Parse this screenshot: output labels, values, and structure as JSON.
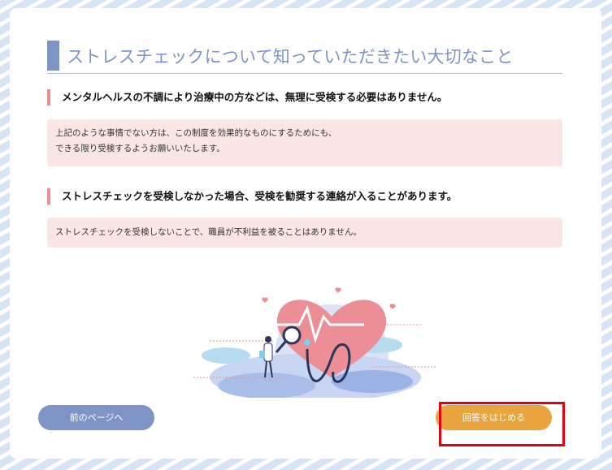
{
  "page": {
    "title": "ストレスチェックについて知っていただきたい大切なこと"
  },
  "sections": [
    {
      "heading": "メンタルヘルスの不調により治療中の方などは、無理に受検する必要はありません。",
      "note_lines": [
        "上記のような事情でない方は、この制度を効果的なものにするためにも、",
        "できる限り受検するようお願いいたします。"
      ]
    },
    {
      "heading": "ストレスチェックを受検しなかった場合、受検を勧奨する連絡が入ることがあります。",
      "note_lines": [
        "ストレスチェックを受検しないことで、職員が不利益を被ることはありません。"
      ]
    }
  ],
  "illustration": {
    "icon": "heart-stethoscope-illustration"
  },
  "buttons": {
    "prev_label": "前のページへ",
    "start_label": "回答をはじめる"
  },
  "colors": {
    "accent": "#7e94c6",
    "primary_button": "#eaa43e",
    "note_bg": "#fbe6e6",
    "heading_bar": "#ec8e95",
    "highlight": "#e60012"
  }
}
